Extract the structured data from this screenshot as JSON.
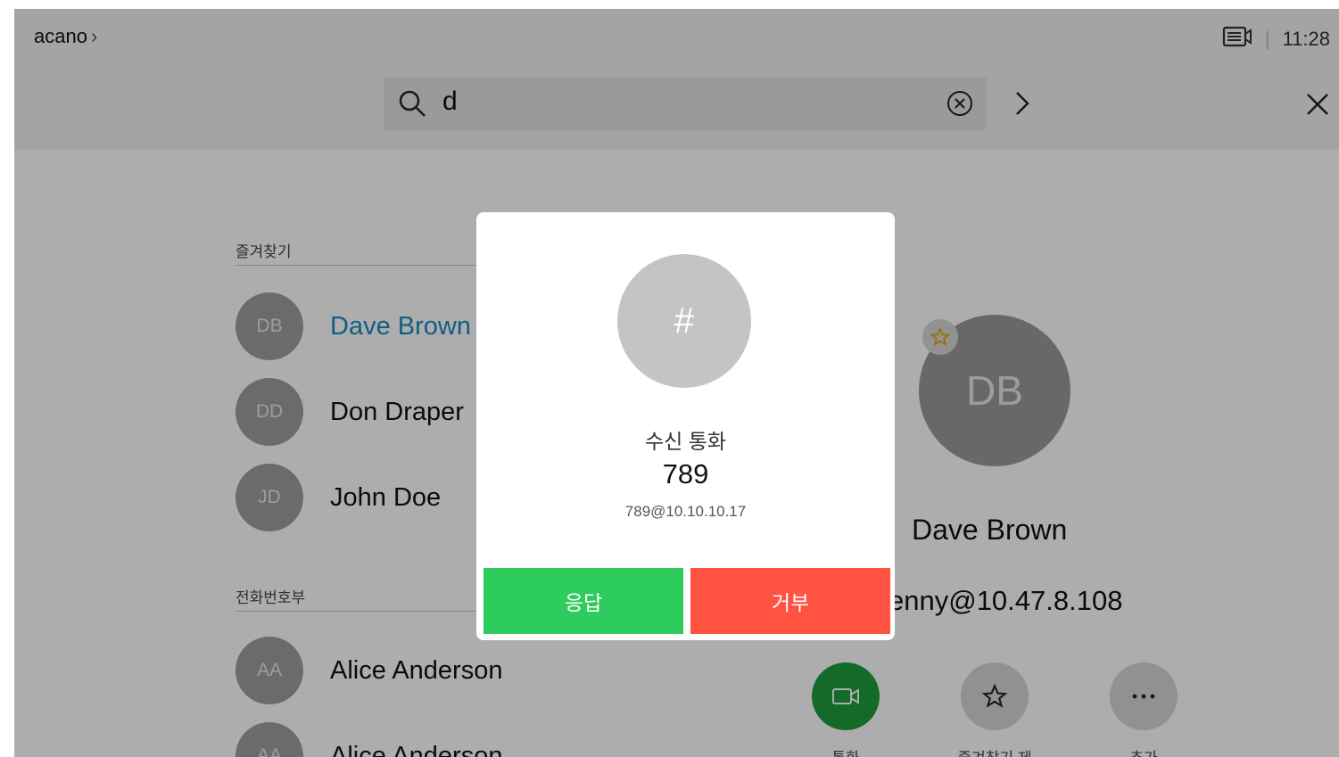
{
  "header": {
    "breadcrumb": "acano",
    "time": "11:28",
    "separator": "|"
  },
  "search": {
    "value": "d"
  },
  "favorites": {
    "heading": "즐겨찾기",
    "items": [
      {
        "initials": "DB",
        "name": "Dave Brown"
      },
      {
        "initials": "DD",
        "name": "Don Draper"
      },
      {
        "initials": "JD",
        "name": "John Doe"
      }
    ]
  },
  "directory": {
    "heading": "전화번호부",
    "items": [
      {
        "initials": "AA",
        "name": "Alice Anderson"
      },
      {
        "initials": "AA",
        "name": "Alice Anderson"
      }
    ]
  },
  "detail": {
    "initials": "DB",
    "name": "Dave Brown",
    "uri": "enny@10.47.8.108",
    "actions": [
      {
        "label": "통화",
        "icon": "video-camera-icon",
        "color": "#1e9c3c"
      },
      {
        "label": "즐겨찾기 제",
        "icon": "star-icon"
      },
      {
        "label": "추가",
        "icon": "more-icon"
      }
    ]
  },
  "incoming_call": {
    "avatar_glyph": "#",
    "title": "수신 통화",
    "number": "789",
    "uri": "789@10.10.10.17",
    "answer_label": "응답",
    "decline_label": "거부",
    "answer_color": "#2ecc5c",
    "decline_color": "#ff5240"
  },
  "colors": {
    "accent": "#1b8dc0",
    "star": "#e0a800"
  }
}
